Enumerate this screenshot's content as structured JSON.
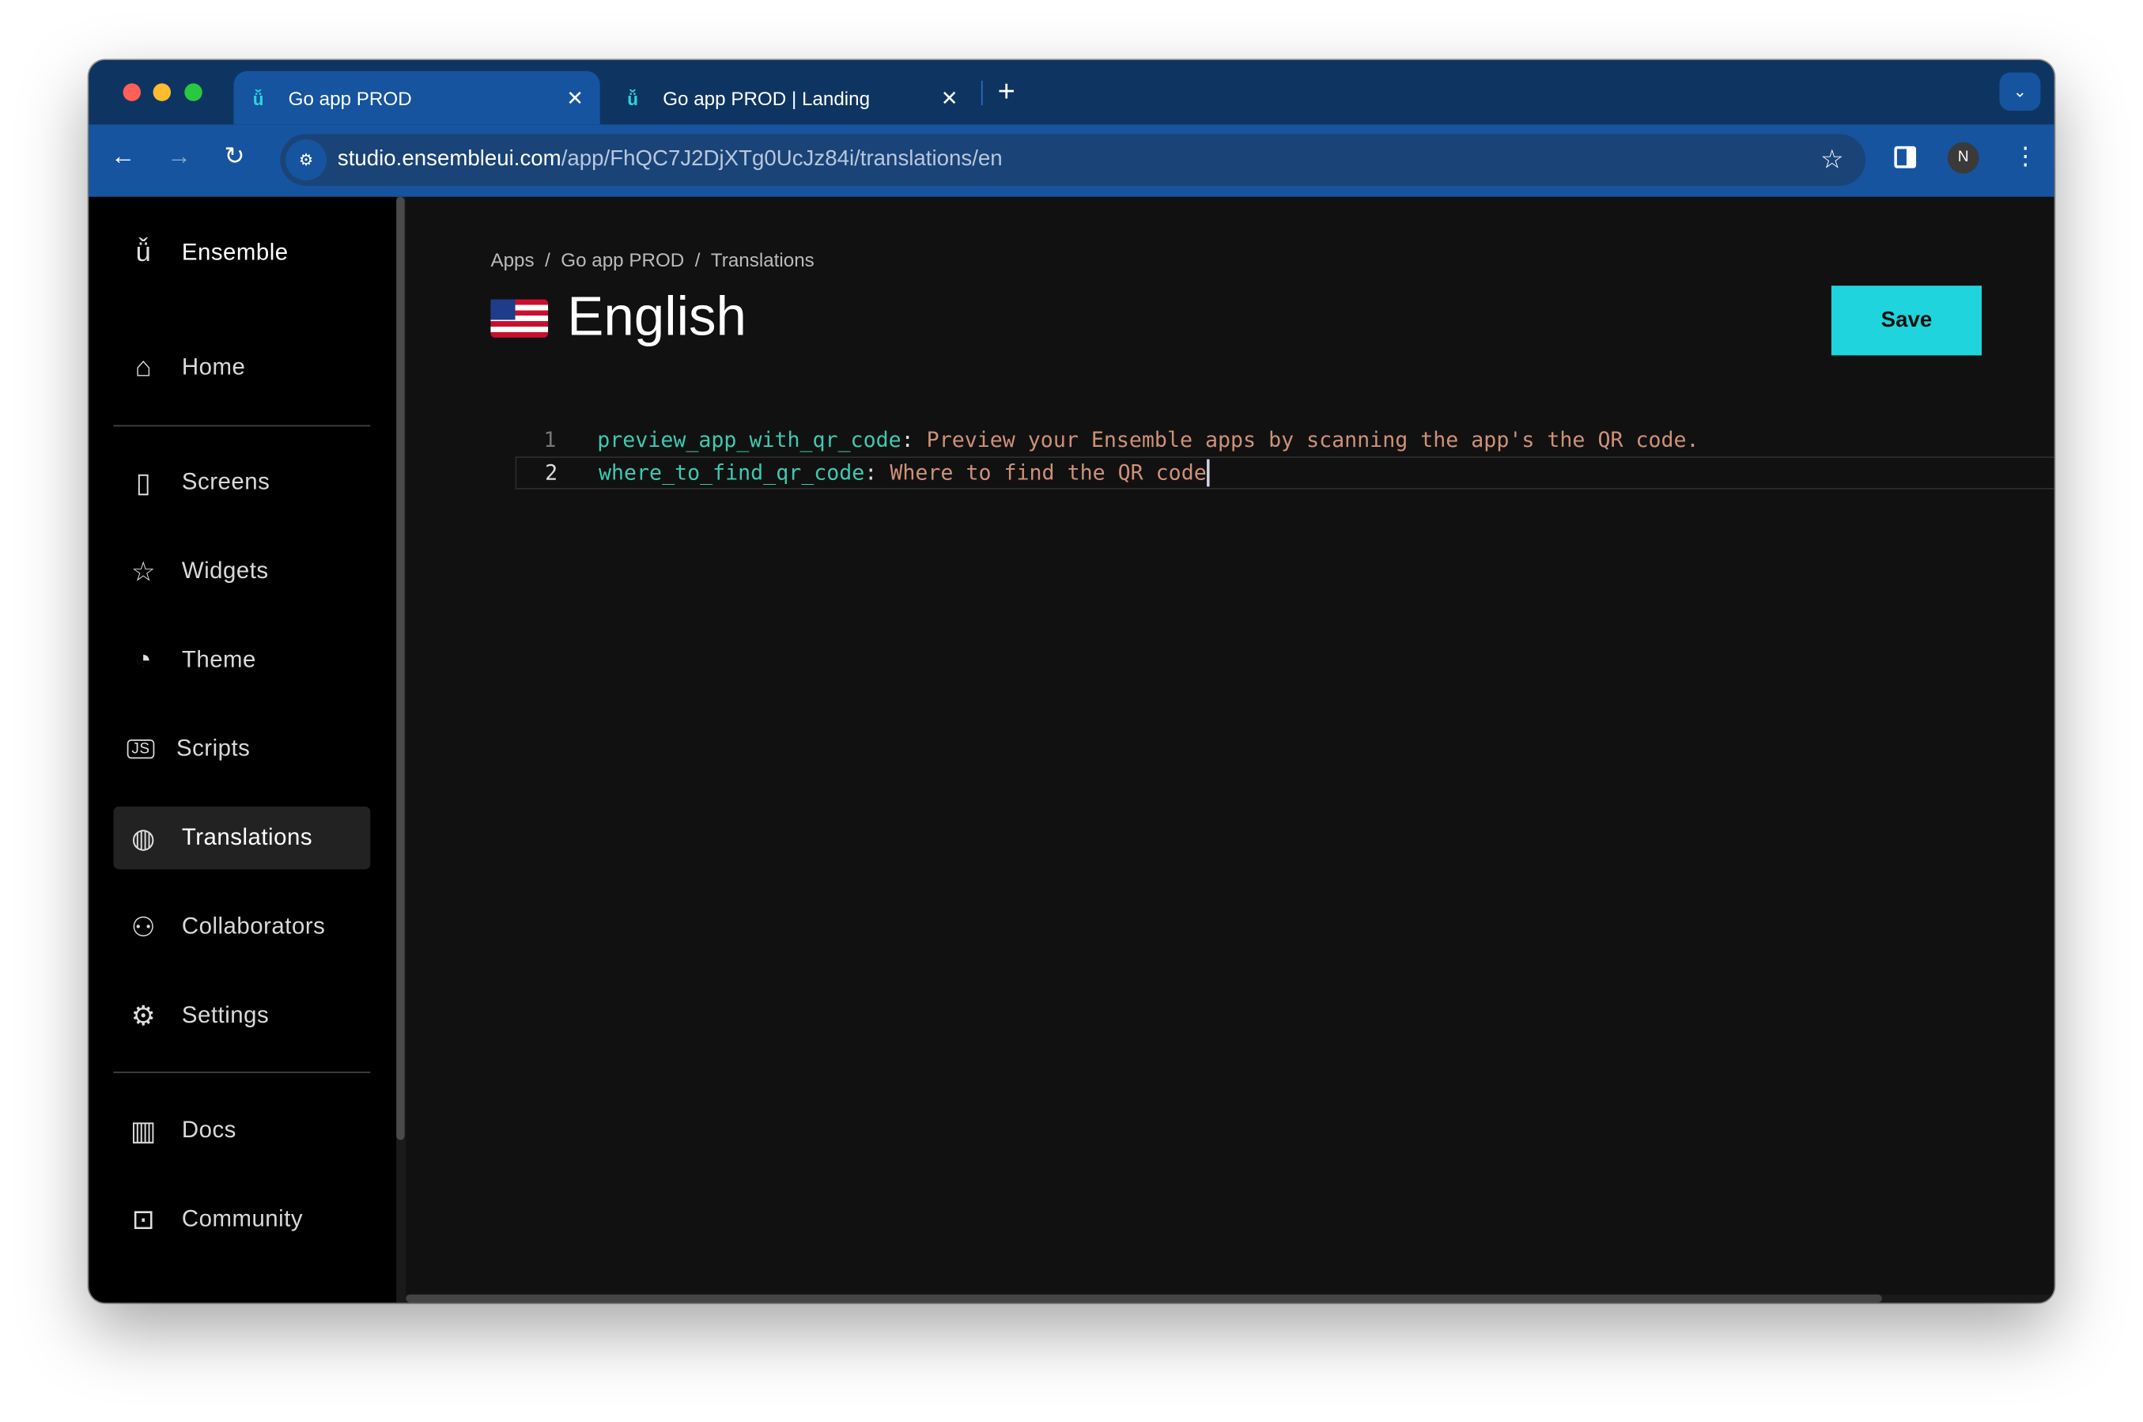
{
  "browser": {
    "tabs": [
      {
        "label": "Go app PROD",
        "active": true
      },
      {
        "label": "Go app PROD | Landing",
        "active": false
      }
    ],
    "url_host": "studio.ensembleui.com",
    "url_path": "/app/FhQC7J2DjXTg0UcJz84i/translations/en",
    "profile_initial": "N"
  },
  "sidebar": {
    "brand": "Ensemble",
    "items": [
      {
        "label": "Home",
        "icon": "home-icon"
      },
      {
        "label": "Screens",
        "icon": "screen-icon"
      },
      {
        "label": "Widgets",
        "icon": "widgets-icon"
      },
      {
        "label": "Theme",
        "icon": "palette-icon"
      },
      {
        "label": "Scripts",
        "icon": "js-icon"
      },
      {
        "label": "Translations",
        "icon": "globe-icon",
        "selected": true
      },
      {
        "label": "Collaborators",
        "icon": "users-icon"
      },
      {
        "label": "Settings",
        "icon": "gear-icon"
      },
      {
        "label": "Docs",
        "icon": "book-icon"
      },
      {
        "label": "Community",
        "icon": "discord-icon"
      }
    ]
  },
  "main": {
    "breadcrumb": [
      "Apps",
      "Go app PROD",
      "Translations"
    ],
    "title": "English",
    "save_label": "Save",
    "accent": "#1fd4dc",
    "editor": {
      "lines": [
        {
          "num": "1",
          "key": "preview_app_with_qr_code",
          "value": "Preview your Ensemble apps by scanning the app's the QR code."
        },
        {
          "num": "2",
          "key": "where_to_find_qr_code",
          "value": "Where to find the QR code"
        }
      ]
    }
  }
}
